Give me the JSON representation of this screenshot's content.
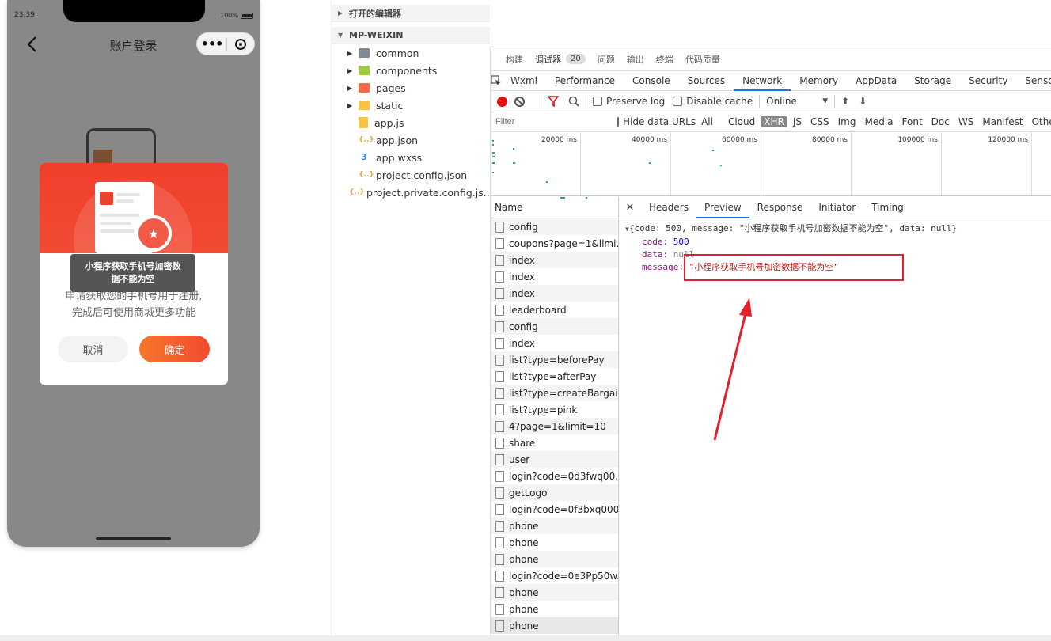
{
  "phone": {
    "time": "23:39",
    "battery": "100%",
    "nav_title": "账户登录",
    "capsule_menu": "•••",
    "modal": {
      "desc_line1": "申请获取您的手机号用于注册,",
      "desc_line2": "完成后可使用商城更多功能",
      "cancel": "取消",
      "confirm": "确定"
    },
    "toast_line1": "小程序获取手机号加密数",
    "toast_line2": "据不能为空"
  },
  "explorer": {
    "open_editors": "打开的编辑器",
    "project": "MP-WEIXIN",
    "items": [
      {
        "label": "common",
        "type": "folder",
        "icon": "folder-grey"
      },
      {
        "label": "components",
        "type": "folder",
        "icon": "folder-green"
      },
      {
        "label": "pages",
        "type": "folder",
        "icon": "folder-red"
      },
      {
        "label": "static",
        "type": "folder",
        "icon": "folder-yellow"
      },
      {
        "label": "app.js",
        "type": "file",
        "icon": "js"
      },
      {
        "label": "app.json",
        "type": "file",
        "icon": "json"
      },
      {
        "label": "app.wxss",
        "type": "file",
        "icon": "css"
      },
      {
        "label": "project.config.json",
        "type": "file",
        "icon": "json"
      },
      {
        "label": "project.private.config.js...",
        "type": "file",
        "icon": "json"
      }
    ]
  },
  "devtools": {
    "top_tabs": [
      "构建",
      "调试器",
      "问题",
      "输出",
      "终端",
      "代码质量"
    ],
    "debugger_count": "20",
    "panel_tabs": [
      "Wxml",
      "Performance",
      "Console",
      "Sources",
      "Network",
      "Memory",
      "AppData",
      "Storage",
      "Security",
      "Sensor"
    ],
    "toolbar": {
      "preserve_log": "Preserve log",
      "disable_cache": "Disable cache",
      "throttle": "Online"
    },
    "filter": {
      "placeholder": "Filter",
      "hide_data_urls": "Hide data URLs",
      "types": [
        "All",
        "Cloud",
        "XHR",
        "JS",
        "CSS",
        "Img",
        "Media",
        "Font",
        "Doc",
        "WS",
        "Manifest",
        "Other"
      ],
      "active_type": "XHR"
    },
    "timeline_labels": [
      "20000 ms",
      "40000 ms",
      "60000 ms",
      "80000 ms",
      "100000 ms",
      "120000 ms"
    ],
    "name_header": "Name",
    "requests": [
      "config",
      "coupons?page=1&limi...",
      "index",
      "index",
      "index",
      "leaderboard",
      "config",
      "index",
      "list?type=beforePay",
      "list?type=afterPay",
      "list?type=createBargain",
      "list?type=pink",
      "4?page=1&limit=10",
      "share",
      "user",
      "login?code=0d3fwq00...",
      "getLogo",
      "login?code=0f3bxq000...",
      "phone",
      "phone",
      "phone",
      "login?code=0e3Pp50w...",
      "phone",
      "phone",
      "phone"
    ],
    "preview_tabs": [
      "Headers",
      "Preview",
      "Response",
      "Initiator",
      "Timing"
    ],
    "preview": {
      "summary": "{code: 500, message: \"小程序获取手机号加密数据不能为空\", data: null}",
      "code_key": "code",
      "code_val": "500",
      "data_key": "data",
      "data_val": "null",
      "message_key": "message",
      "message_val": "\"小程序获取手机号加密数据不能为空\""
    }
  },
  "colors": {
    "accent": "#1a73e8",
    "brand_red": "#ef3f2c",
    "annotation_red": "#e5202a"
  }
}
